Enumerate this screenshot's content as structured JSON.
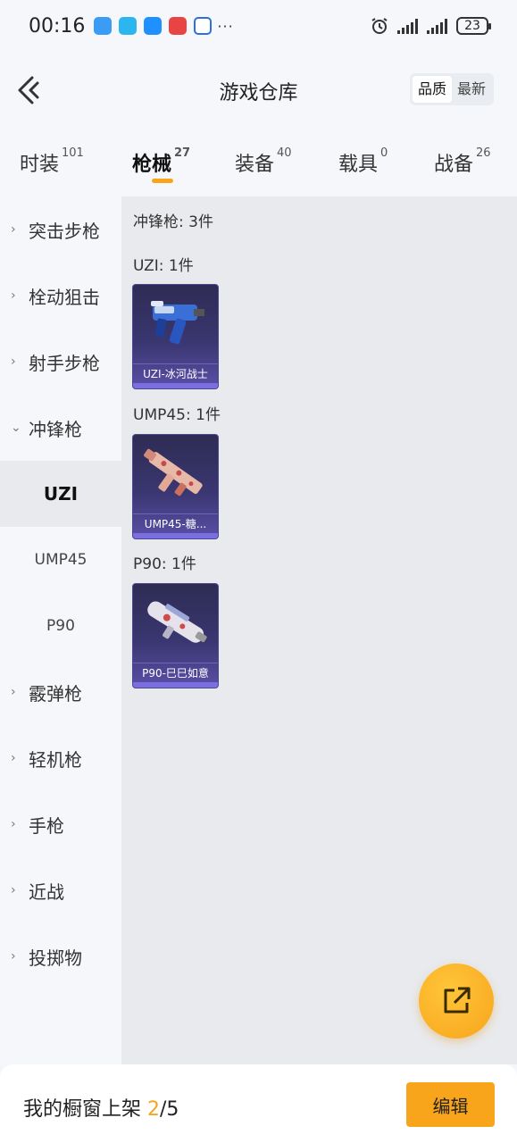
{
  "status_bar": {
    "time": "00:16",
    "more": "···",
    "battery": "23"
  },
  "header": {
    "title": "游戏仓库",
    "sort_options": [
      "品质",
      "最新"
    ]
  },
  "tabs": [
    {
      "label": "时装",
      "count": "101"
    },
    {
      "label": "枪械",
      "count": "27"
    },
    {
      "label": "装备",
      "count": "40"
    },
    {
      "label": "载具",
      "count": "0"
    },
    {
      "label": "战备",
      "count": "26"
    }
  ],
  "sidebar": {
    "items": [
      {
        "label": "突击步枪"
      },
      {
        "label": "栓动狙击"
      },
      {
        "label": "射手步枪"
      },
      {
        "label": "冲锋枪"
      },
      {
        "label": "UZI"
      },
      {
        "label": "UMP45"
      },
      {
        "label": "P90"
      },
      {
        "label": "霰弹枪"
      },
      {
        "label": "轻机枪"
      },
      {
        "label": "手枪"
      },
      {
        "label": "近战"
      },
      {
        "label": "投掷物"
      }
    ]
  },
  "main": {
    "category_summary": "冲锋枪: 3件",
    "groups": [
      {
        "label": "UZI: 1件",
        "item_name": "UZI-冰河战士"
      },
      {
        "label": "UMP45: 1件",
        "item_name": "UMP45-糖..."
      },
      {
        "label": "P90: 1件",
        "item_name": "P90-巳巳如意"
      }
    ]
  },
  "bottom_bar": {
    "showcase_label": "我的橱窗上架",
    "showcase_current": "2",
    "showcase_total": "/5",
    "edit_label": "编辑"
  },
  "colors": {
    "accent": "#f8a51b",
    "card_bg": "#3a3670"
  }
}
